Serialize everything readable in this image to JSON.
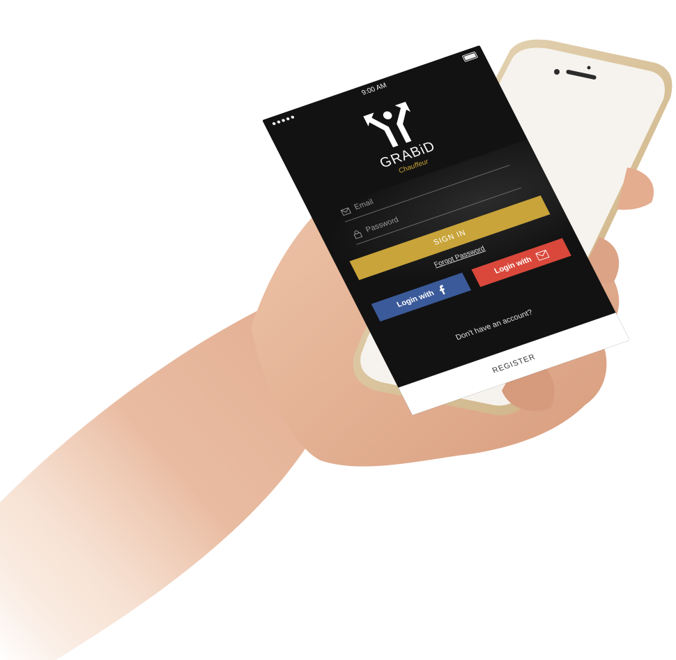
{
  "status_bar": {
    "carrier": "●●●●● ",
    "time": "9:00 AM"
  },
  "app": {
    "brand": "GRABiD",
    "tagline": "Chauffeur"
  },
  "form": {
    "email_placeholder": "Email",
    "password_placeholder": "Password",
    "signin_label": "SIGN IN",
    "forgot_label": "Forgot Password",
    "facebook_label": "Login with",
    "mail_label": "Login with",
    "no_account_text": "Don't have an account?",
    "register_label": "REGISTER"
  },
  "colors": {
    "accent_gold": "#c9a43a",
    "facebook_blue": "#3b5a9a",
    "mail_red": "#d9483b",
    "screen_bg": "#121212",
    "phone_body": "#f3efe8",
    "phone_rim": "#d9c39a"
  },
  "icons": [
    "arrows-logo-icon",
    "mail-icon",
    "lock-icon",
    "facebook-icon",
    "envelope-icon",
    "battery-icon"
  ]
}
